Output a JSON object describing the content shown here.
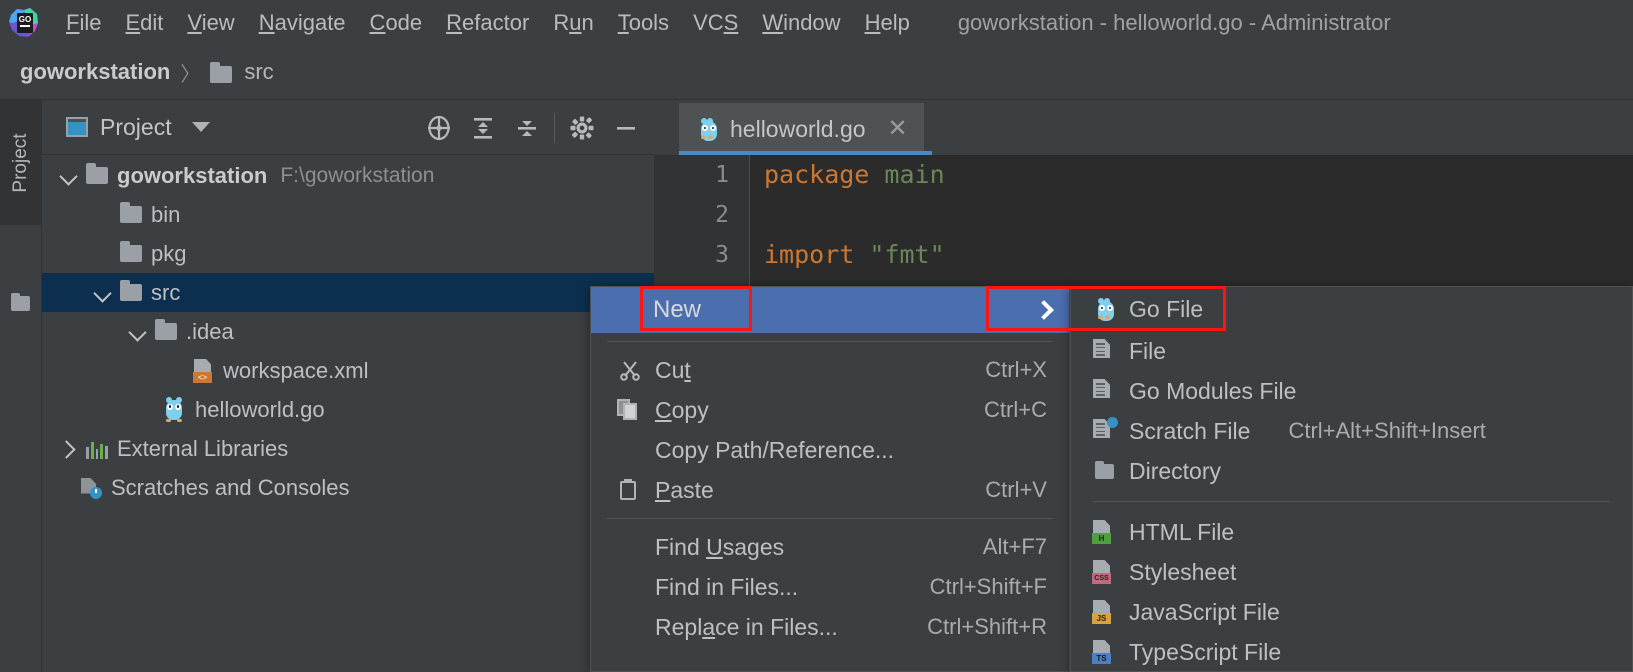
{
  "window": {
    "title": "goworkstation - helloworld.go - Administrator",
    "logo_icon": "goland-logo-icon"
  },
  "menubar": {
    "items": [
      {
        "label": "File",
        "mnemonic": "F"
      },
      {
        "label": "Edit",
        "mnemonic": "E"
      },
      {
        "label": "View",
        "mnemonic": "V"
      },
      {
        "label": "Navigate",
        "mnemonic": "N"
      },
      {
        "label": "Code",
        "mnemonic": "C"
      },
      {
        "label": "Refactor",
        "mnemonic": "R"
      },
      {
        "label": "Run",
        "mnemonic": "u"
      },
      {
        "label": "Tools",
        "mnemonic": "T"
      },
      {
        "label": "VCS",
        "mnemonic": "S"
      },
      {
        "label": "Window",
        "mnemonic": "W"
      },
      {
        "label": "Help",
        "mnemonic": "H"
      }
    ]
  },
  "breadcrumb": {
    "root": "goworkstation",
    "separator": "〉",
    "leaf": "src",
    "leaf_icon": "folder-icon"
  },
  "toolstrip": {
    "project_tab_label": "Project",
    "project_tab_icon": "folder-icon"
  },
  "project_panel": {
    "title": "Project",
    "title_icon": "project-view-icon",
    "caret_icon": "chevron-down-icon",
    "tools": [
      {
        "name": "locate-icon",
        "title": "Select Opened File"
      },
      {
        "name": "expand-all-icon",
        "title": "Expand All"
      },
      {
        "name": "collapse-all-icon",
        "title": "Collapse All"
      },
      {
        "name": "gear-icon",
        "title": "Settings"
      },
      {
        "name": "minimize-icon",
        "title": "Hide"
      }
    ],
    "tree": [
      {
        "label": "goworkstation",
        "path": "F:\\goworkstation",
        "icon": "folder-icon",
        "twisty": "open",
        "indent": 0,
        "bold": true,
        "selected": false
      },
      {
        "label": "bin",
        "path": "",
        "icon": "folder-icon",
        "twisty": "none",
        "indent": 1,
        "bold": false,
        "selected": false
      },
      {
        "label": "pkg",
        "path": "",
        "icon": "folder-icon",
        "twisty": "none",
        "indent": 1,
        "bold": false,
        "selected": false
      },
      {
        "label": "src",
        "path": "",
        "icon": "folder-icon",
        "twisty": "open",
        "indent": 1,
        "bold": false,
        "selected": true
      },
      {
        "label": ".idea",
        "path": "",
        "icon": "folder-icon",
        "twisty": "open",
        "indent": 2,
        "bold": false,
        "selected": false
      },
      {
        "label": "workspace.xml",
        "path": "",
        "icon": "xml-file-icon",
        "twisty": "none",
        "indent": 3,
        "bold": false,
        "selected": false
      },
      {
        "label": "helloworld.go",
        "path": "",
        "icon": "go-file-icon",
        "twisty": "none",
        "indent": 2,
        "bold": false,
        "selected": false
      },
      {
        "label": "External Libraries",
        "path": "",
        "icon": "libraries-icon",
        "twisty": "closed",
        "indent": 0,
        "bold": false,
        "selected": false
      },
      {
        "label": "Scratches and Consoles",
        "path": "",
        "icon": "scratches-icon",
        "twisty": "none",
        "indent": 0,
        "bold": false,
        "selected": false
      }
    ]
  },
  "editor": {
    "tab": {
      "label": "helloworld.go",
      "icon": "go-file-icon",
      "close_icon": "close-icon"
    },
    "lines": [
      {
        "number": "1",
        "tokens": [
          {
            "t": "package",
            "c": "kw"
          },
          {
            "t": " ",
            "c": "id"
          },
          {
            "t": "main",
            "c": "str"
          }
        ]
      },
      {
        "number": "2",
        "tokens": []
      },
      {
        "number": "3",
        "tokens": [
          {
            "t": "import",
            "c": "kw"
          },
          {
            "t": " ",
            "c": "id"
          },
          {
            "t": "\"fmt\"",
            "c": "str"
          }
        ]
      }
    ]
  },
  "context_menu": {
    "new_item": {
      "label": "New",
      "submenu_arrow_icon": "chevron-right-icon",
      "highlighted": true
    },
    "items": [
      {
        "label": "Cut",
        "mnemonic": "t",
        "shortcut": "Ctrl+X",
        "icon": "cut-icon"
      },
      {
        "label": "Copy",
        "mnemonic": "C",
        "shortcut": "Ctrl+C",
        "icon": "copy-icon"
      },
      {
        "label": "Copy Path/Reference...",
        "mnemonic": "",
        "shortcut": "",
        "icon": "none"
      },
      {
        "label": "Paste",
        "mnemonic": "P",
        "shortcut": "Ctrl+V",
        "icon": "paste-icon"
      },
      {
        "separator": true
      },
      {
        "label": "Find Usages",
        "mnemonic": "U",
        "shortcut": "Alt+F7",
        "icon": "none"
      },
      {
        "label": "Find in Files...",
        "mnemonic": "",
        "shortcut": "Ctrl+Shift+F",
        "icon": "none"
      },
      {
        "label": "Replace in Files...",
        "mnemonic": "a",
        "shortcut": "Ctrl+Shift+R",
        "icon": "none"
      }
    ]
  },
  "submenu": {
    "items": [
      {
        "label": "Go File",
        "shortcut": "",
        "icon": "go-file-icon",
        "badge": "",
        "badge_color": ""
      },
      {
        "label": "File",
        "shortcut": "",
        "icon": "file-icon",
        "badge": "",
        "badge_color": ""
      },
      {
        "label": "Go Modules File",
        "shortcut": "",
        "icon": "file-icon",
        "badge": "",
        "badge_color": ""
      },
      {
        "label": "Scratch File",
        "shortcut": "Ctrl+Alt+Shift+Insert",
        "icon": "scratch-file-icon",
        "badge": "",
        "badge_color": ""
      },
      {
        "label": "Directory",
        "shortcut": "",
        "icon": "folder-icon",
        "badge": "",
        "badge_color": ""
      },
      {
        "separator": true
      },
      {
        "label": "HTML File",
        "shortcut": "",
        "icon": "html-file-icon",
        "badge": "H",
        "badge_color": "#4f9e3f"
      },
      {
        "label": "Stylesheet",
        "shortcut": "",
        "icon": "css-file-icon",
        "badge": "CSS",
        "badge_color": "#c2697f"
      },
      {
        "label": "JavaScript File",
        "shortcut": "",
        "icon": "js-file-icon",
        "badge": "JS",
        "badge_color": "#d6a340"
      },
      {
        "label": "TypeScript File",
        "shortcut": "",
        "icon": "ts-file-icon",
        "badge": "TS",
        "badge_color": "#4f7fc0"
      }
    ]
  },
  "annotations": {
    "highlight_color": "#ff1414",
    "boxes": [
      {
        "name": "new-menu-item-highlight"
      },
      {
        "name": "submenu-arrow-and-go-file-highlight"
      }
    ]
  },
  "colors": {
    "selection_blue": "#4b6eaf",
    "tree_selection": "#0d2f4f",
    "tab_underline": "#4a88c7",
    "editor_bg": "#2b2b2b",
    "panel_bg": "#3c3f41"
  }
}
